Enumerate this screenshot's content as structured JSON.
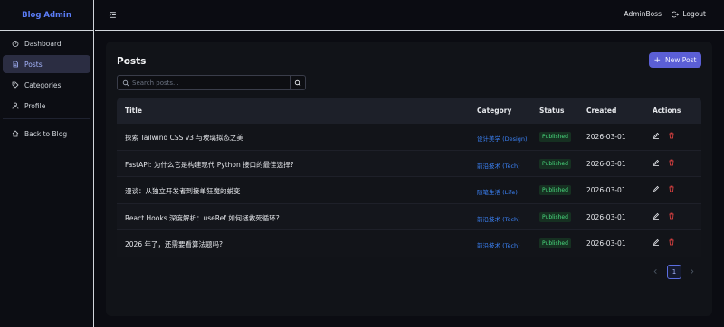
{
  "app": {
    "brand": "Blog Admin"
  },
  "sidebar": {
    "items": [
      {
        "label": "Dashboard",
        "icon": "dashboard-icon",
        "active": false
      },
      {
        "label": "Posts",
        "icon": "document-icon",
        "active": true
      },
      {
        "label": "Categories",
        "icon": "tag-icon",
        "active": false
      },
      {
        "label": "Profile",
        "icon": "user-icon",
        "active": false
      }
    ],
    "back": {
      "label": "Back to Blog",
      "icon": "home-icon"
    }
  },
  "topbar": {
    "user": "AdminBoss",
    "logout_label": "Logout"
  },
  "page": {
    "title": "Posts",
    "new_button": "New Post",
    "search": {
      "placeholder": "Search posts...",
      "value": ""
    }
  },
  "table": {
    "columns": [
      "Title",
      "Category",
      "Status",
      "Created",
      "Actions"
    ],
    "rows": [
      {
        "title": "探索 Tailwind CSS v3 与玻璃拟态之美",
        "category": "设计美学 (Design)",
        "status": "Published",
        "created": "2026-03-01"
      },
      {
        "title": "FastAPI: 为什么它是构建现代 Python 接口的最佳选择?",
        "category": "前沿技术 (Tech)",
        "status": "Published",
        "created": "2026-03-01"
      },
      {
        "title": "漫谈：从独立开发者到接单狂魔的蜕变",
        "category": "随笔生活 (Life)",
        "status": "Published",
        "created": "2026-03-01"
      },
      {
        "title": "React Hooks 深度解析：useRef 如何拯救死循环?",
        "category": "前沿技术 (Tech)",
        "status": "Published",
        "created": "2026-03-01"
      },
      {
        "title": "2026 年了，还需要看算法题吗?",
        "category": "前沿技术 (Tech)",
        "status": "Published",
        "created": "2026-03-01"
      }
    ]
  },
  "pagination": {
    "current": "1"
  },
  "colors": {
    "accent": "#5b5fd6",
    "brand": "#5b7cf6",
    "status_published": "#4ade80",
    "category_link": "#3b82f6"
  }
}
